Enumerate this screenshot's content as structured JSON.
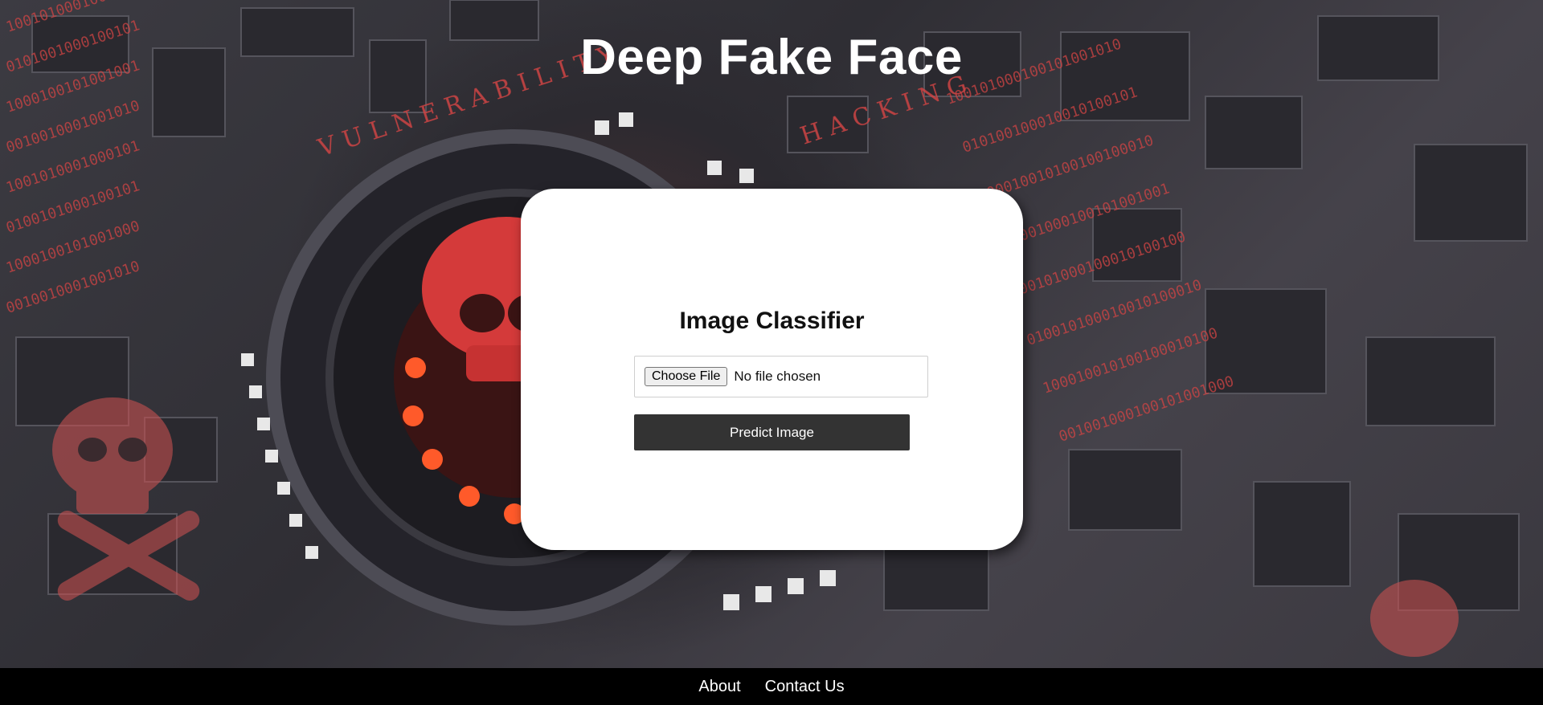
{
  "page": {
    "title": "Deep Fake Face",
    "background_text": [
      "VULNERABILITY",
      "HACKING"
    ]
  },
  "card": {
    "title": "Image Classifier",
    "file_input": {
      "button_label": "Choose File",
      "status_text": "No file chosen"
    },
    "predict_button_label": "Predict Image"
  },
  "footer": {
    "links": [
      {
        "label": "About"
      },
      {
        "label": "Contact Us"
      }
    ]
  },
  "colors": {
    "title_text": "#ffffff",
    "card_bg": "#ffffff",
    "predict_button_bg": "#333333",
    "footer_bg": "#000000",
    "accent_red": "#e0302a"
  }
}
